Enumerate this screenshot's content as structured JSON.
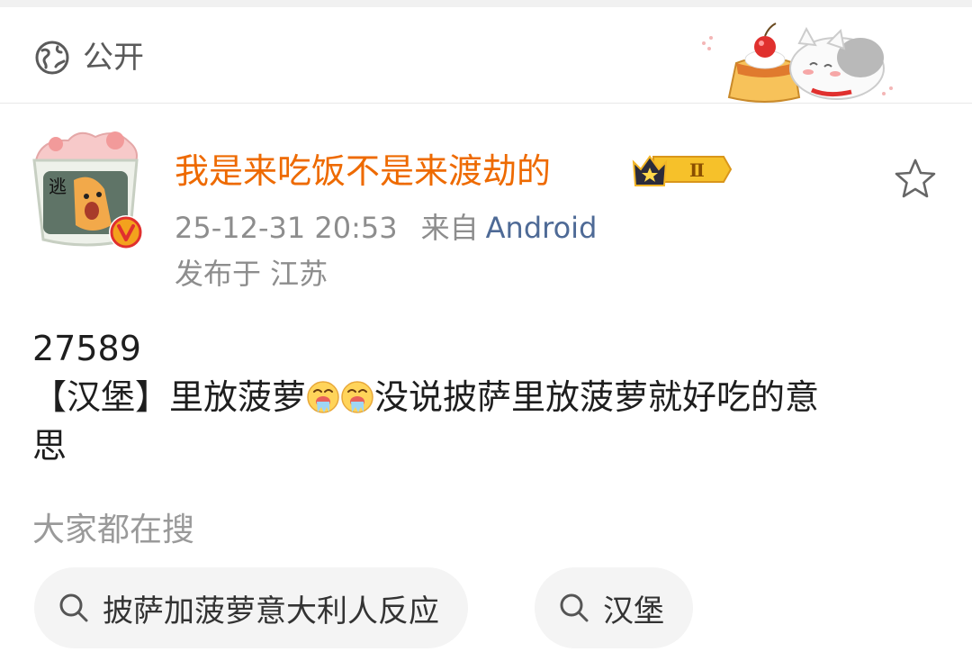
{
  "header": {
    "visibility_label": "公开",
    "visibility_icon": "globe-icon"
  },
  "post": {
    "username": "我是来吃饭不是来渡劫的",
    "badge_text": "Ⅱ",
    "timestamp": "25-12-31 20:53",
    "source_prefix": "来自",
    "source_app": "Android",
    "location": "发布于 江苏",
    "body_line1": "27589",
    "body_line2_a": "【汉堡】里放菠萝",
    "body_line2_b": "没说披萨里放菠萝就好吃的意",
    "body_line3": "思"
  },
  "search": {
    "title": "大家都在搜",
    "chips": [
      {
        "label": "披萨加菠萝意大利人反应"
      },
      {
        "label": "汉堡"
      }
    ]
  },
  "colors": {
    "username": "#ee6a00",
    "source_app": "#4e6a96",
    "meta": "#8d8d8d",
    "chip_bg": "#f4f4f4"
  }
}
